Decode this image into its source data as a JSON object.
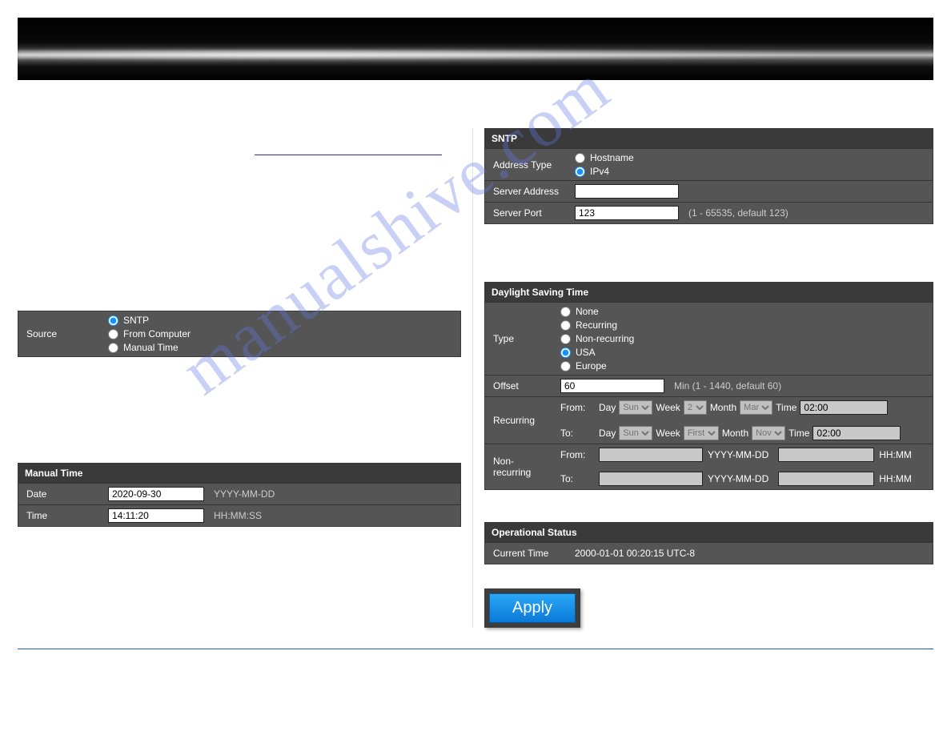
{
  "watermark": "manualshive.com",
  "left": {
    "source": {
      "label": "Source",
      "options": {
        "sntp": "SNTP",
        "from_computer": "From Computer",
        "manual": "Manual Time"
      },
      "selected": "sntp"
    },
    "manual": {
      "header": "Manual Time",
      "date_label": "Date",
      "date_value": "2020-09-30",
      "date_hint": "YYYY-MM-DD",
      "time_label": "Time",
      "time_value": "14:11:20",
      "time_hint": "HH:MM:SS"
    }
  },
  "right": {
    "sntp": {
      "header": "SNTP",
      "addr_type_label": "Address Type",
      "addr_type_options": {
        "hostname": "Hostname",
        "ipv4": "IPv4"
      },
      "addr_type_selected": "ipv4",
      "server_addr_label": "Server Address",
      "server_addr_value": "",
      "server_port_label": "Server Port",
      "server_port_value": "123",
      "server_port_hint": "(1 - 65535, default 123)"
    },
    "dst": {
      "header": "Daylight Saving Time",
      "type_label": "Type",
      "type_options": {
        "none": "None",
        "recurring": "Recurring",
        "nonrecurring": "Non-recurring",
        "usa": "USA",
        "europe": "Europe"
      },
      "type_selected": "usa",
      "offset_label": "Offset",
      "offset_value": "60",
      "offset_hint": "Min (1 - 1440, default 60)",
      "recurring_label": "Recurring",
      "rec_from_prefix": "From:",
      "rec_to_prefix": "To:",
      "rec_day": "Day",
      "rec_week": "Week",
      "rec_month": "Month",
      "rec_time": "Time",
      "rec_from": {
        "day": "Sun",
        "week": "2",
        "month": "Mar",
        "time": "02:00"
      },
      "rec_to": {
        "day": "Sun",
        "week": "First",
        "month": "Nov",
        "time": "02:00"
      },
      "nonrecurring_label": "Non-recurring",
      "nrec_from_prefix": "From:",
      "nrec_to_prefix": "To:",
      "nrec_date_hint": "YYYY-MM-DD",
      "nrec_time_hint": "HH:MM",
      "nrec_from": {
        "date": "",
        "time": ""
      },
      "nrec_to": {
        "date": "",
        "time": ""
      }
    },
    "ops": {
      "header": "Operational Status",
      "current_label": "Current Time",
      "current_value": "2000-01-01 00:20:15 UTC-8"
    },
    "apply": "Apply"
  }
}
